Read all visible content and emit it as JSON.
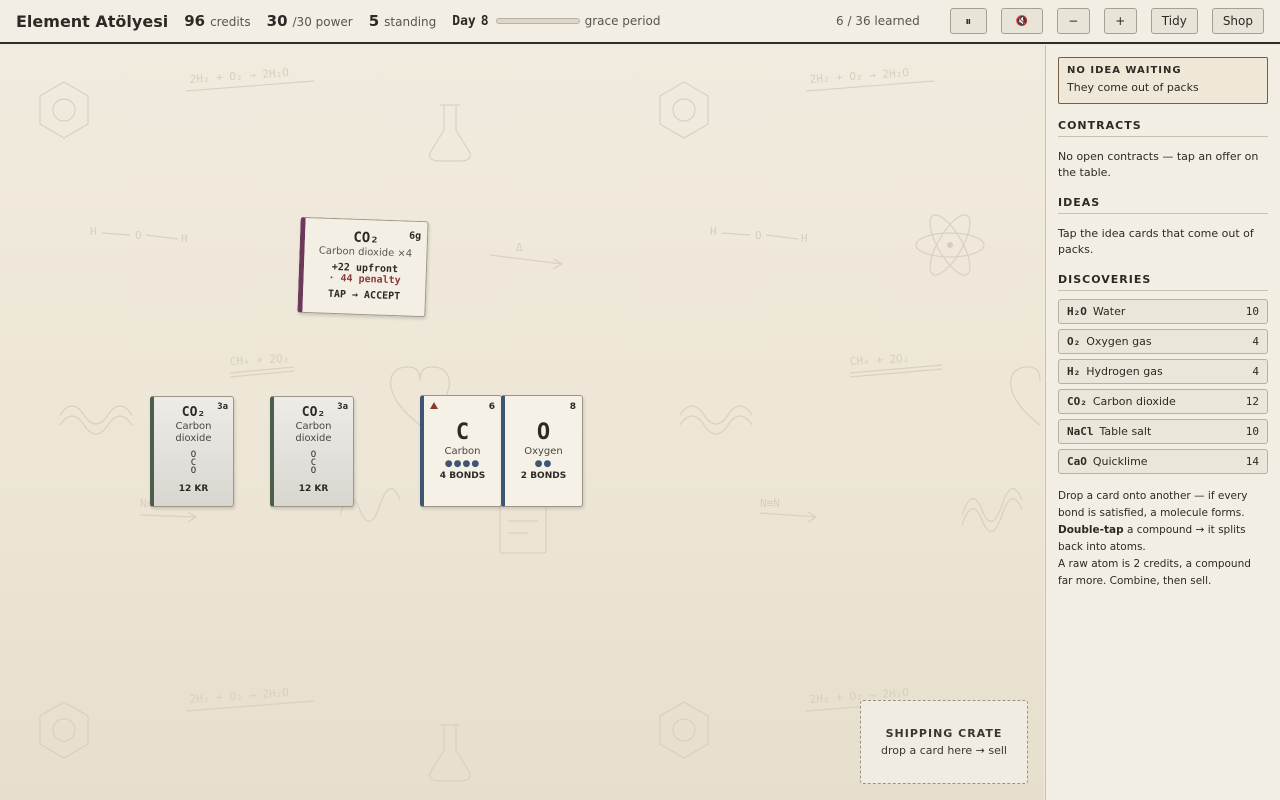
{
  "header": {
    "title": "Element Atölyesi",
    "credits_value": "96",
    "credits_label": "credits",
    "power_value": "30",
    "power_label": "/30 power",
    "standing_value": "5",
    "standing_label": "standing",
    "day_label": "Day",
    "day_value": "8",
    "grace_progress": 0,
    "grace_label": "grace period",
    "learned": "6 / 36 learned",
    "pause_label": "⏸",
    "audio_label": "🔇",
    "zoom_out_label": "−",
    "zoom_in_label": "+",
    "tidy_label": "Tidy",
    "shop_label": "Shop"
  },
  "board": {
    "contract": {
      "formula": "CO₂",
      "tag": "6g",
      "name": "Carbon dioxide ×4",
      "upfront": "+22 upfront",
      "penalty": "· 44 penalty",
      "action": "TAP → ACCEPT"
    },
    "compounds": [
      {
        "formula": "CO₂",
        "tag": "3a",
        "name_line1": "Carbon",
        "name_line2": "dioxide",
        "s1": "O",
        "s2": "C",
        "s3": "O",
        "price": "12 KR"
      },
      {
        "formula": "CO₂",
        "tag": "3a",
        "name_line1": "Carbon",
        "name_line2": "dioxide",
        "s1": "O",
        "s2": "C",
        "s3": "O",
        "price": "12 KR"
      }
    ],
    "atoms": [
      {
        "symbol": "C",
        "number": "6",
        "name": "Carbon",
        "dots": "●●●●",
        "bonds": "4 BONDS"
      },
      {
        "symbol": "O",
        "number": "8",
        "name": "Oxygen",
        "dots": "●●",
        "bonds": "2 BONDS"
      }
    ],
    "crate": {
      "title": "SHIPPING CRATE",
      "subtitle": "drop a card here → sell"
    },
    "bg_text": {
      "eq1": "2H₂ + O₂ → 2H₂O",
      "eq2": "CH₄ + 2O₂",
      "hoh_h": "H",
      "hoh_o": "O",
      "delta": "Δ",
      "nn": "N≡N"
    }
  },
  "sidebar": {
    "idea_title": "NO IDEA WAITING",
    "idea_text": "They come out of packs",
    "contracts_title": "CONTRACTS",
    "contracts_text": "No open contracts — tap an offer on the table.",
    "ideas_title": "IDEAS",
    "ideas_text": "Tap the idea cards that come out of packs.",
    "discoveries_title": "DISCOVERIES",
    "discoveries": [
      {
        "formula": "H₂O",
        "name": "Water",
        "count": "10"
      },
      {
        "formula": "O₂",
        "name": "Oxygen gas",
        "count": "4"
      },
      {
        "formula": "H₂",
        "name": "Hydrogen gas",
        "count": "4"
      },
      {
        "formula": "CO₂",
        "name": "Carbon dioxide",
        "count": "12"
      },
      {
        "formula": "NaCl",
        "name": "Table salt",
        "count": "10"
      },
      {
        "formula": "CaO",
        "name": "Quicklime",
        "count": "14"
      }
    ],
    "help_1": "Drop a card onto another — if every bond is satisfied, a molecule forms.",
    "help_2_bold": "Double-tap",
    "help_2": " a compound → it splits back into atoms.",
    "help_3": "A raw atom is 2 credits, a compound far more. Combine, then sell."
  }
}
